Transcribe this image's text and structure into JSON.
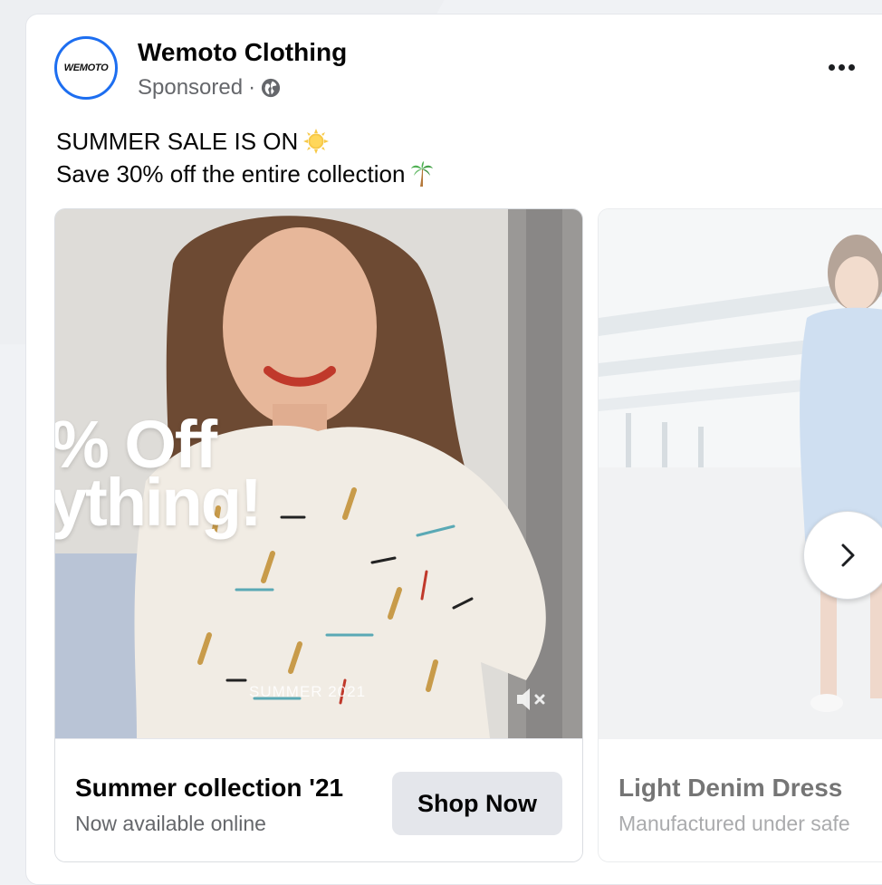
{
  "brand": {
    "logo_text": "WEMOTO",
    "accent": "#1d6ef0"
  },
  "header": {
    "page_name": "Wemoto Clothing",
    "sponsored": "Sponsored",
    "separator": "·",
    "audience_icon": "globe-icon",
    "more_icon": "more-horizontal-icon"
  },
  "post": {
    "line1": "SUMMER SALE IS ON",
    "line1_emoji": "sun-icon",
    "line2": "Save 30% off the entire collection",
    "line2_emoji": "palm-tree-icon"
  },
  "carousel": {
    "cards": [
      {
        "overlay_line1": "% Off",
        "overlay_line2": "ything!",
        "overlay_tag": "SUMMER 2021",
        "headline": "Summer collection '21",
        "description": "Now available online",
        "cta": "Shop Now"
      },
      {
        "headline": "Light Denim Dress",
        "description": "Manufactured under safe"
      }
    ],
    "next_icon": "chevron-right-icon"
  },
  "colors": {
    "text_primary": "#050505",
    "text_secondary": "#65676b",
    "button_bg": "#e4e6eb"
  }
}
